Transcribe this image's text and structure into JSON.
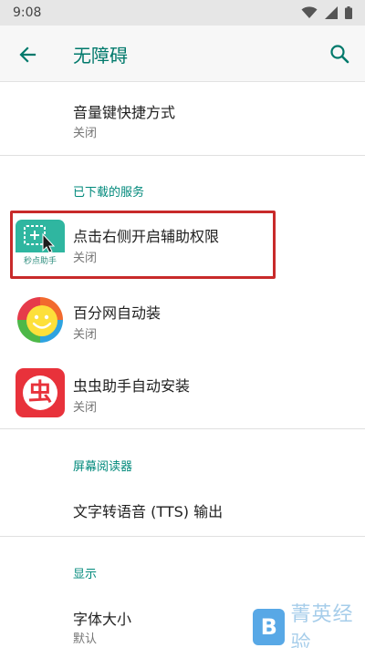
{
  "status_bar": {
    "time": "9:08"
  },
  "app_bar": {
    "title": "无障碍",
    "back_icon": "arrow-back-icon",
    "search_icon": "search-icon"
  },
  "accent_color": "#00796b",
  "items": {
    "volume_shortcut": {
      "title": "音量键快捷方式",
      "summary": "关闭"
    },
    "downloaded_header": "已下载的服务",
    "service_1": {
      "title": "点击右侧开启辅助权限",
      "summary": "关闭",
      "icon_label": "秒点助手"
    },
    "service_2": {
      "title": "百分网自动装",
      "summary": "关闭"
    },
    "service_3": {
      "title": "虫虫助手自动安装",
      "summary": "关闭",
      "icon_glyph": "虫"
    },
    "screen_reader_header": "屏幕阅读器",
    "tts": {
      "title": "文字转语音 (TTS) 输出"
    },
    "display_header": "显示",
    "font_size": {
      "title": "字体大小",
      "summary": "默认"
    }
  },
  "watermark": {
    "logo": "B",
    "text": "菁英经验"
  }
}
